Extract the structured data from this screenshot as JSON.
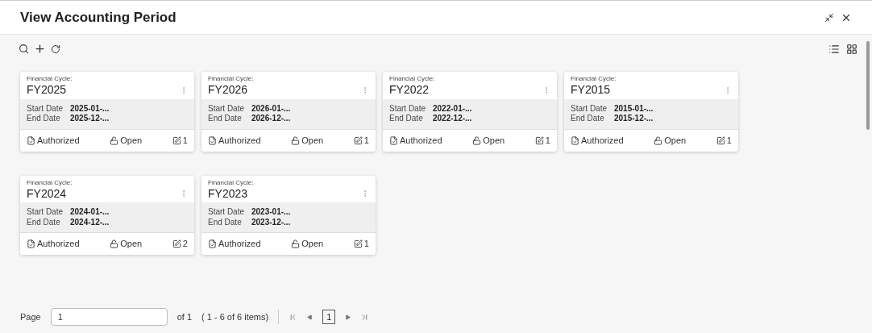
{
  "window": {
    "title": "View Accounting Period"
  },
  "cards": [
    {
      "label": "Financial Cycle:",
      "cycle": "FY2025",
      "fields": [
        {
          "label": "Start Date",
          "value": "2025-01-..."
        },
        {
          "label": "End Date",
          "value": "2025-12-..."
        }
      ],
      "auth": "Authorized",
      "status": "Open",
      "count": "1"
    },
    {
      "label": "Financial Cycle:",
      "cycle": "FY2026",
      "fields": [
        {
          "label": "Start Date",
          "value": "2026-01-..."
        },
        {
          "label": "End Date",
          "value": "2026-12-..."
        }
      ],
      "auth": "Authorized",
      "status": "Open",
      "count": "1"
    },
    {
      "label": "Financial Cycle:",
      "cycle": "FY2022",
      "fields": [
        {
          "label": "Start Date",
          "value": "2022-01-..."
        },
        {
          "label": "End Date",
          "value": "2022-12-..."
        }
      ],
      "auth": "Authorized",
      "status": "Open",
      "count": "1"
    },
    {
      "label": "Financial Cycle:",
      "cycle": "FY2015",
      "fields": [
        {
          "label": "Start Date",
          "value": "2015-01-..."
        },
        {
          "label": "End Date",
          "value": "2015-12-..."
        }
      ],
      "auth": "Authorized",
      "status": "Open",
      "count": "1"
    },
    {
      "label": "Financial Cycle:",
      "cycle": "FY2024",
      "fields": [
        {
          "label": "Start Date",
          "value": "2024-01-..."
        },
        {
          "label": "End Date",
          "value": "2024-12-..."
        }
      ],
      "auth": "Authorized",
      "status": "Open",
      "count": "2"
    },
    {
      "label": "Financial Cycle:",
      "cycle": "FY2023",
      "fields": [
        {
          "label": "Start Date",
          "value": "2023-01-..."
        },
        {
          "label": "End Date",
          "value": "2023-12-..."
        }
      ],
      "auth": "Authorized",
      "status": "Open",
      "count": "1"
    }
  ],
  "pagination": {
    "label": "Page",
    "value": "1",
    "of": "of 1",
    "range": "( 1 - 6 of 6 items)",
    "current": "1"
  }
}
